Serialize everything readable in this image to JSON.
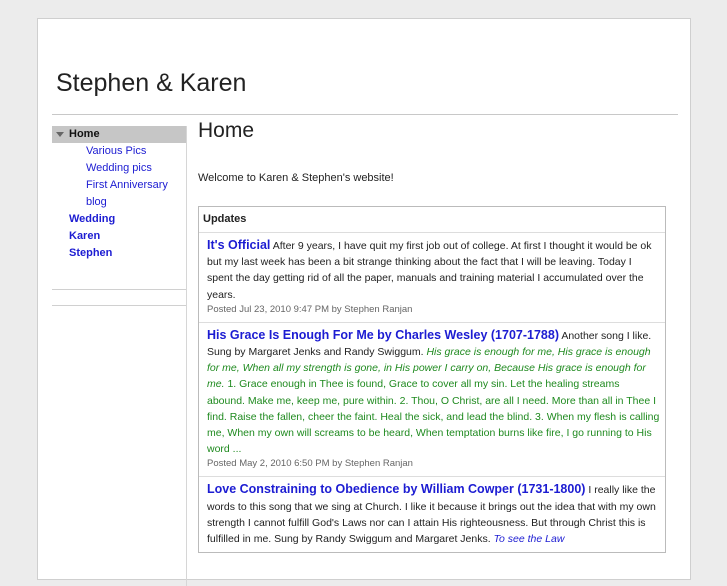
{
  "site": {
    "title": "Stephen & Karen"
  },
  "nav": {
    "home": "Home",
    "sub_items": [
      "Various Pics",
      "Wedding pics",
      "First Anniversary",
      "blog"
    ],
    "top_items": [
      "Wedding",
      "Karen",
      "Stephen"
    ]
  },
  "main": {
    "heading": "Home",
    "welcome": "Welcome to Karen & Stephen's website!"
  },
  "updates": {
    "title": "Updates",
    "posts": [
      {
        "title": "It's Official",
        "body": "After 9 years, I have quit my first job out of college. At first I thought it would be ok but my last week has been a bit strange thinking about the fact that I will be leaving. Today I spent the day getting rid of all the paper, manuals and training material I accumulated over the years.",
        "meta": "Posted Jul 23, 2010 9:47 PM by Stephen Ranjan"
      },
      {
        "title": "His Grace Is Enough For Me by Charles Wesley (1707-1788)",
        "body_intro": "Another song I like. Sung by Margaret Jenks and Randy Swiggum.",
        "body_quote": "His grace is enough for me, His grace is enough for me, When all my strength is gone, in His power I carry on, Because His grace is enough for me.",
        "body_verses": "1.  Grace enough in Thee is found, Grace to cover all my sin. Let the healing streams abound. Make me, keep me, pure within.  2.  Thou, O Christ, are all I need. More than all in Thee I find. Raise the fallen, cheer the faint. Heal the sick, and lead the blind.  3.  When my flesh is calling me, When my own will screams to be heard, When temptation burns like fire, I go running to His word ...",
        "meta": "Posted May 2, 2010 6:50 PM by Stephen Ranjan"
      },
      {
        "title": "Love Constraining to Obedience by William Cowper (1731-1800)",
        "body": "I really like the words to this song that we sing at Church. I like it because it brings out the idea that with my own strength I cannot fulfill God's Laws nor can I attain His righteousness. But through Christ this is fulfilled in me.  Sung by Randy Swiggum and Margaret Jenks.",
        "body_quote": "To see the Law"
      }
    ]
  },
  "colors": {
    "link": "#1c1cd2",
    "quote_green": "#1f8a1f",
    "nav_highlight": "#c6c6c6"
  }
}
